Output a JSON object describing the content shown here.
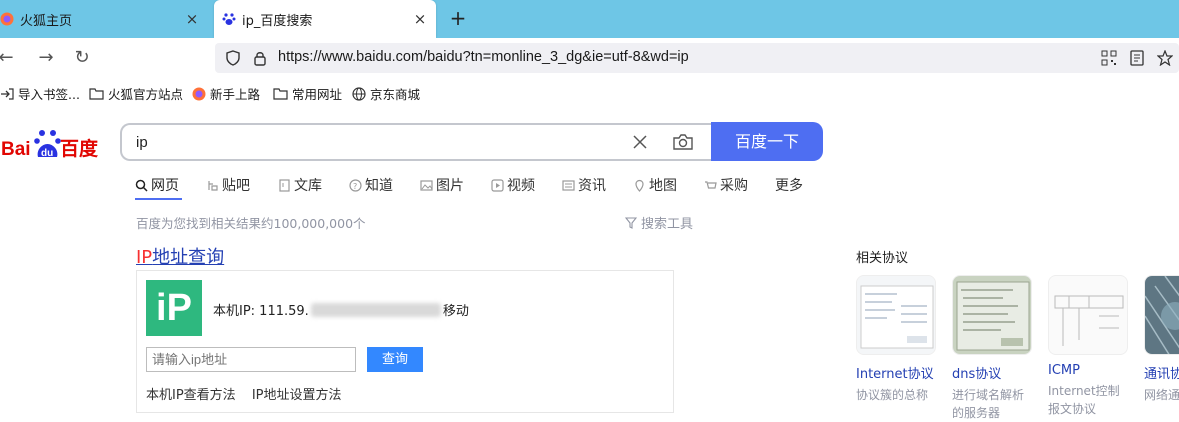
{
  "browser": {
    "tabs": [
      {
        "title": "火狐主页",
        "close": "×"
      },
      {
        "title": "ip_百度搜索",
        "close": "×"
      }
    ],
    "new_tab": "+",
    "url": "https://www.baidu.com/baidu?tn=monline_3_dg&ie=utf-8&wd=ip",
    "nav": {
      "back": "←",
      "forward": "→",
      "reload": "↻"
    },
    "bookmarks": [
      "导入书签...",
      "火狐官方站点",
      "新手上路",
      "常用网址",
      "京东商城"
    ]
  },
  "search": {
    "query": "ip",
    "button_label": "百度一下",
    "tabs": [
      "网页",
      "贴吧",
      "文库",
      "知道",
      "图片",
      "视频",
      "资讯",
      "地图",
      "采购",
      "更多"
    ],
    "result_count": "百度为您找到相关结果约100,000,000个",
    "tools_label": "搜索工具"
  },
  "ip_card": {
    "title_highlight": "IP",
    "title_rest": "地址查询",
    "badge": "iP",
    "ip_prefix": "本机IP: 111.59.",
    "ip_suffix": "移动",
    "input_placeholder": "请输入ip地址",
    "query_button": "查询",
    "links": [
      "本机IP查看方法",
      "IP地址设置方法"
    ]
  },
  "related": {
    "heading": "相关协议",
    "items": [
      {
        "name": "Internet协议",
        "desc": "协议簇的总称"
      },
      {
        "name": "dns协议",
        "desc": "进行域名解析的服务器"
      },
      {
        "name": "ICMP",
        "desc": "Internet控制报文协议"
      },
      {
        "name": "通讯协",
        "desc": "网络通"
      }
    ]
  },
  "colors": {
    "accent": "#4e6ef2",
    "tab_strip": "#6ec6e6",
    "link": "#2440b3",
    "highlight": "#f73131",
    "ip_badge": "#2eb87f"
  }
}
